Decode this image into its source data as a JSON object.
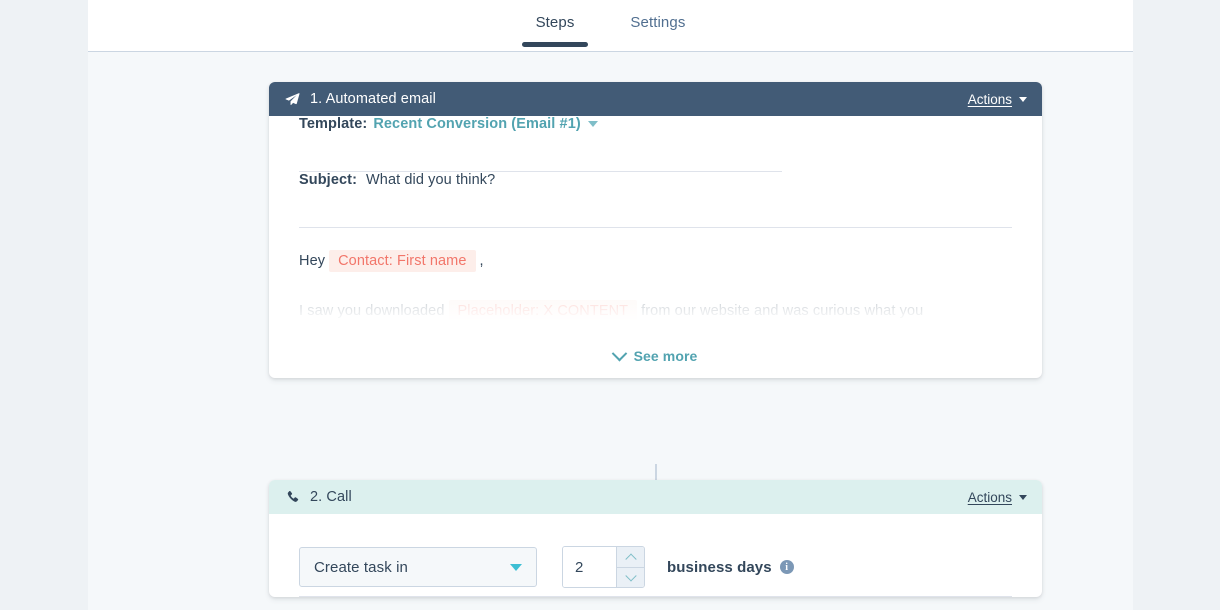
{
  "tabs": [
    {
      "label": "Steps",
      "active": true
    },
    {
      "label": "Settings",
      "active": false
    }
  ],
  "steps": [
    {
      "header": {
        "icon": "paper-plane-icon",
        "title": "1. Automated email",
        "actions_label": "Actions"
      },
      "template": {
        "label": "Template:",
        "value": "Recent Conversion (Email #1)"
      },
      "subject": {
        "label": "Subject:",
        "value": "What did you think?"
      },
      "preview": {
        "line1_before": "Hey",
        "line1_token": "Contact: First name",
        "line1_after": ",",
        "line2_before": "I saw you downloaded",
        "line2_token": "Placeholder: X CONTENT",
        "line2_after": "from our website and was curious what you"
      },
      "see_more_label": "See more"
    },
    {
      "header": {
        "icon": "phone-icon",
        "title": "2. Call",
        "actions_label": "Actions"
      },
      "form": {
        "action_select_value": "Create task in",
        "delay_value": "2",
        "delay_unit_label": "business days"
      }
    }
  ],
  "connector": {
    "add_step_label": "+"
  },
  "colors": {
    "email_header_bg": "#425b76",
    "call_header_bg": "#dcf0ee",
    "accent_teal": "#52a3b0",
    "token_text": "#f2766a",
    "token_bg": "#fdeeea",
    "page_bg": "#f5f8fa",
    "gutter_bg": "#eef2f5",
    "text_primary": "#33475b"
  }
}
